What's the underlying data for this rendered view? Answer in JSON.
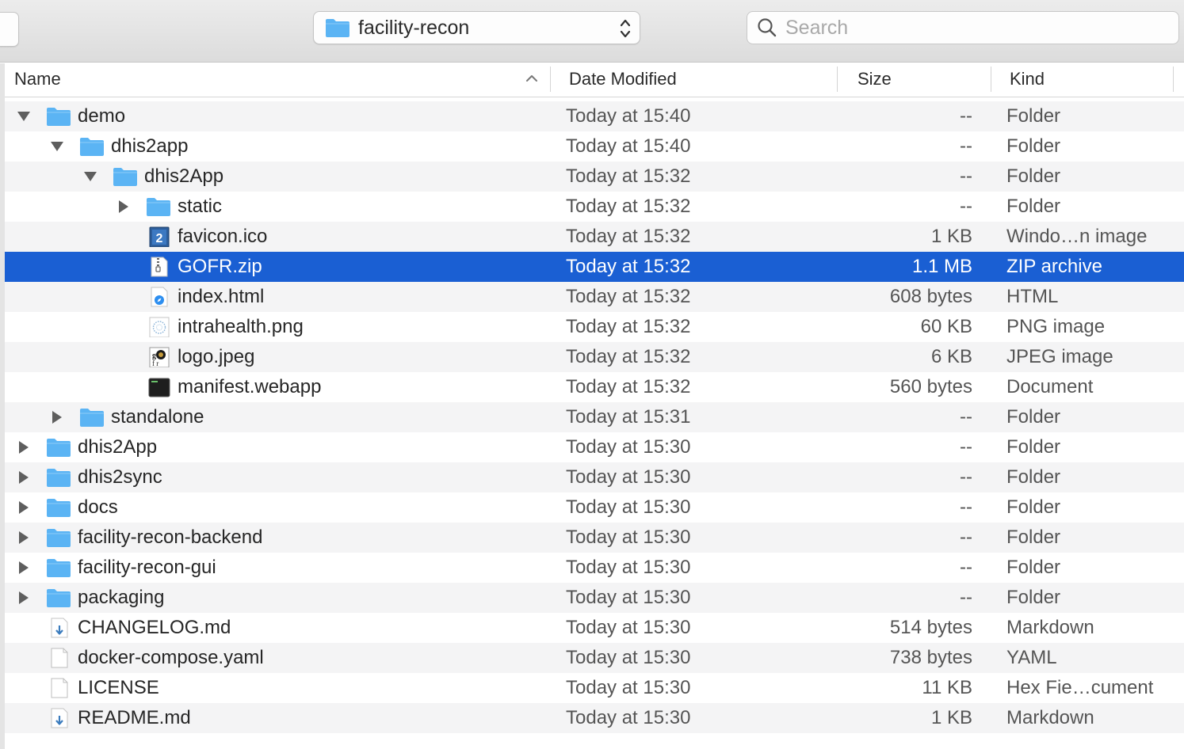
{
  "toolbar": {
    "path_label": "facility-recon",
    "search_placeholder": "Search"
  },
  "columns": {
    "name": "Name",
    "date": "Date Modified",
    "size": "Size",
    "kind": "Kind"
  },
  "colors": {
    "selection": "#1a5fd3",
    "folder": "#5bb4f4",
    "alt_row": "#f4f4f5"
  },
  "rows": [
    {
      "name": "demo",
      "date": "Today at 15:40",
      "size": "--",
      "kind": "Folder",
      "level": 0,
      "type": "folder",
      "disclosure": "expanded"
    },
    {
      "name": "dhis2app",
      "date": "Today at 15:40",
      "size": "--",
      "kind": "Folder",
      "level": 1,
      "type": "folder",
      "disclosure": "expanded"
    },
    {
      "name": "dhis2App",
      "date": "Today at 15:32",
      "size": "--",
      "kind": "Folder",
      "level": 2,
      "type": "folder",
      "disclosure": "expanded"
    },
    {
      "name": "static",
      "date": "Today at 15:32",
      "size": "--",
      "kind": "Folder",
      "level": 3,
      "type": "folder",
      "disclosure": "collapsed"
    },
    {
      "name": "favicon.ico",
      "date": "Today at 15:32",
      "size": "1 KB",
      "kind": "Windo…n image",
      "level": 3,
      "type": "ico",
      "disclosure": "none"
    },
    {
      "name": "GOFR.zip",
      "date": "Today at 15:32",
      "size": "1.1 MB",
      "kind": "ZIP archive",
      "level": 3,
      "type": "zip",
      "disclosure": "none",
      "selected": true
    },
    {
      "name": "index.html",
      "date": "Today at 15:32",
      "size": "608 bytes",
      "kind": "HTML",
      "level": 3,
      "type": "html",
      "disclosure": "none"
    },
    {
      "name": "intrahealth.png",
      "date": "Today at 15:32",
      "size": "60 KB",
      "kind": "PNG image",
      "level": 3,
      "type": "png",
      "disclosure": "none"
    },
    {
      "name": "logo.jpeg",
      "date": "Today at 15:32",
      "size": "6 KB",
      "kind": "JPEG image",
      "level": 3,
      "type": "jpeg",
      "disclosure": "none"
    },
    {
      "name": "manifest.webapp",
      "date": "Today at 15:32",
      "size": "560 bytes",
      "kind": "Document",
      "level": 3,
      "type": "exec",
      "disclosure": "none"
    },
    {
      "name": "standalone",
      "date": "Today at 15:31",
      "size": "--",
      "kind": "Folder",
      "level": 1,
      "type": "folder",
      "disclosure": "collapsed"
    },
    {
      "name": "dhis2App",
      "date": "Today at 15:30",
      "size": "--",
      "kind": "Folder",
      "level": 0,
      "type": "folder",
      "disclosure": "collapsed"
    },
    {
      "name": "dhis2sync",
      "date": "Today at 15:30",
      "size": "--",
      "kind": "Folder",
      "level": 0,
      "type": "folder",
      "disclosure": "collapsed"
    },
    {
      "name": "docs",
      "date": "Today at 15:30",
      "size": "--",
      "kind": "Folder",
      "level": 0,
      "type": "folder",
      "disclosure": "collapsed"
    },
    {
      "name": "facility-recon-backend",
      "date": "Today at 15:30",
      "size": "--",
      "kind": "Folder",
      "level": 0,
      "type": "folder",
      "disclosure": "collapsed"
    },
    {
      "name": "facility-recon-gui",
      "date": "Today at 15:30",
      "size": "--",
      "kind": "Folder",
      "level": 0,
      "type": "folder",
      "disclosure": "collapsed"
    },
    {
      "name": "packaging",
      "date": "Today at 15:30",
      "size": "--",
      "kind": "Folder",
      "level": 0,
      "type": "folder",
      "disclosure": "collapsed"
    },
    {
      "name": "CHANGELOG.md",
      "date": "Today at 15:30",
      "size": "514 bytes",
      "kind": "Markdown",
      "level": 0,
      "type": "md",
      "disclosure": "none"
    },
    {
      "name": "docker-compose.yaml",
      "date": "Today at 15:30",
      "size": "738 bytes",
      "kind": "YAML",
      "level": 0,
      "type": "doc",
      "disclosure": "none"
    },
    {
      "name": "LICENSE",
      "date": "Today at 15:30",
      "size": "11 KB",
      "kind": "Hex Fie…cument",
      "level": 0,
      "type": "doc",
      "disclosure": "none"
    },
    {
      "name": "README.md",
      "date": "Today at 15:30",
      "size": "1 KB",
      "kind": "Markdown",
      "level": 0,
      "type": "md",
      "disclosure": "none"
    }
  ]
}
